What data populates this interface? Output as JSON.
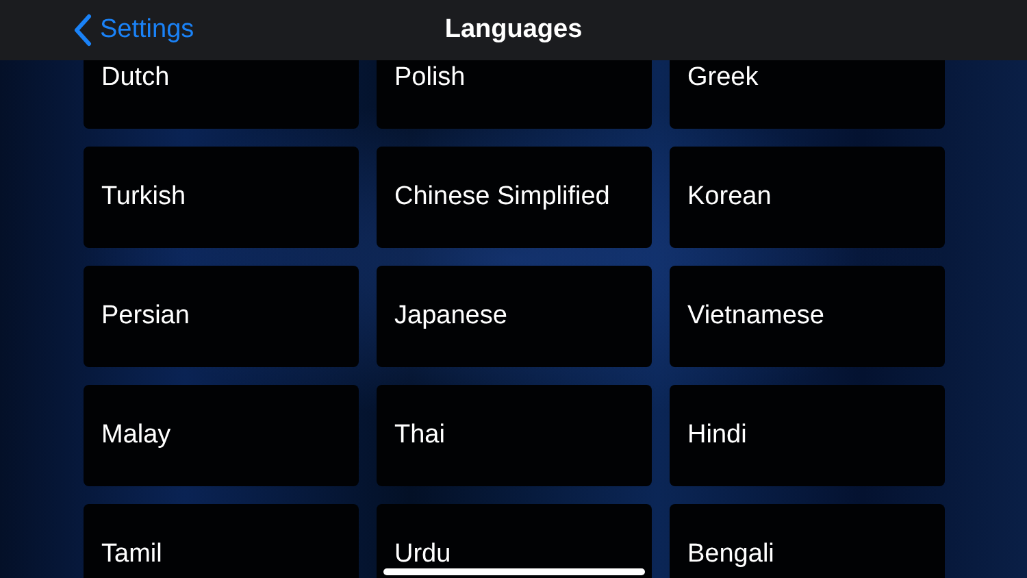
{
  "nav_bar": {
    "back_label": "Settings",
    "title": "Languages"
  },
  "languages": [
    {
      "label": "Dutch"
    },
    {
      "label": "Polish"
    },
    {
      "label": "Greek"
    },
    {
      "label": "Turkish"
    },
    {
      "label": "Chinese Simplified"
    },
    {
      "label": "Korean"
    },
    {
      "label": "Persian"
    },
    {
      "label": "Japanese"
    },
    {
      "label": "Vietnamese"
    },
    {
      "label": "Malay"
    },
    {
      "label": "Thai"
    },
    {
      "label": "Hindi"
    },
    {
      "label": "Tamil"
    },
    {
      "label": "Urdu"
    },
    {
      "label": "Bengali"
    }
  ]
}
